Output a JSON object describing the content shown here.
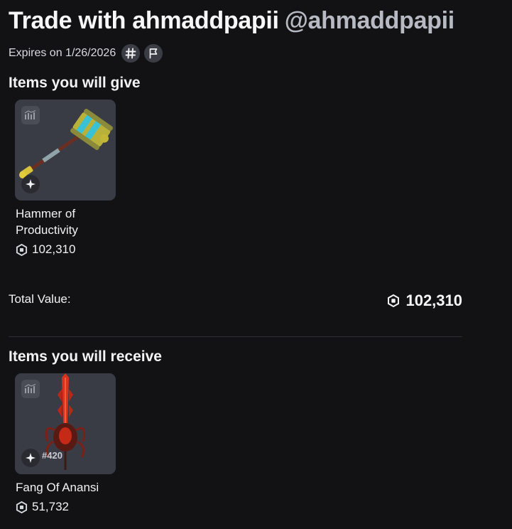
{
  "header": {
    "title": "Trade with ahmaddpapii",
    "handle": "@ahmaddpapii",
    "expires": "Expires on 1/26/2026"
  },
  "give": {
    "section_title": "Items you will give",
    "items": [
      {
        "name": "Hammer of Productivity",
        "price": "102,310"
      }
    ],
    "total_label": "Total Value:",
    "total_value": "102,310"
  },
  "receive": {
    "section_title": "Items you will receive",
    "items": [
      {
        "name": "Fang Of Anansi",
        "price": "51,732",
        "serial": "#420"
      }
    ]
  },
  "icons": {
    "hash": "hash-icon",
    "report": "flag-icon",
    "currency": "robux-icon",
    "chart": "price-chart-icon",
    "limited": "limited-sparkle-icon"
  },
  "colors": {
    "background": "#121215",
    "tile": "#3a3c45",
    "muted_text": "#b7b9c3"
  }
}
